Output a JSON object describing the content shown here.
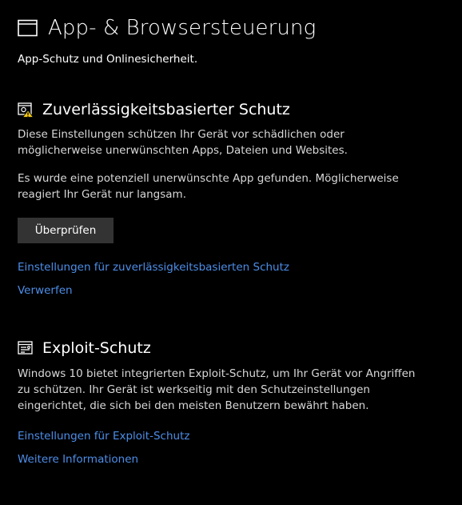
{
  "header": {
    "icon": "app-browser-window-icon",
    "title": "App- & Browsersteuerung",
    "subtitle": "App-Schutz und Onlinesicherheit."
  },
  "reputation": {
    "icon": "reputation-shield-warning-icon",
    "title": "Zuverlässigkeitsbasierter Schutz",
    "description": "Diese Einstellungen schützen Ihr Gerät vor schädlichen oder möglicherweise unerwünschten Apps, Dateien und Websites.",
    "warning": "Es wurde eine potenziell unerwünschte App gefunden. Möglicherweise reagiert Ihr Gerät nur langsam.",
    "check_button": "Überprüfen",
    "settings_link": "Einstellungen für zuverlässigkeitsbasierten Schutz",
    "dismiss_link": "Verwerfen"
  },
  "exploit": {
    "icon": "exploit-protection-icon",
    "title": "Exploit-Schutz",
    "description": "Windows 10 bietet integrierten Exploit-Schutz, um Ihr Gerät vor Angriffen zu schützen.   Ihr Gerät ist werkseitig mit den Schutzeinstellungen eingerichtet, die sich bei den meisten Benutzern bewährt haben.",
    "settings_link": "Einstellungen für Exploit-Schutz",
    "more_info_link": "Weitere Informationen"
  },
  "colors": {
    "background": "#000000",
    "text": "#ffffff",
    "link": "#4d8ee8",
    "button": "#333333",
    "warning_badge": "#f2c811"
  }
}
